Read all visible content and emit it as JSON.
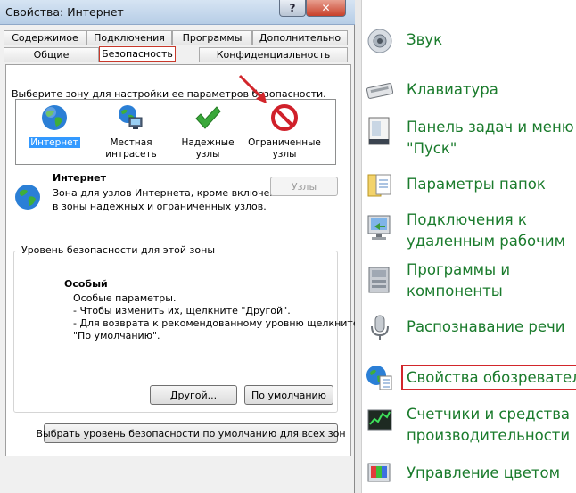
{
  "window": {
    "title": "Свойства: Интернет",
    "help_glyph": "?",
    "close_glyph": "✕"
  },
  "tabs": {
    "row1": [
      "Содержимое",
      "Подключения",
      "Программы",
      "Дополнительно"
    ],
    "row2": [
      "Общие",
      "Безопасность",
      "Конфиденциальность"
    ],
    "active": "Безопасность"
  },
  "security": {
    "instruction": "Выберите зону для настройки ее параметров безопасности.",
    "zones": [
      {
        "label_line1": "Интернет",
        "label_line2": "",
        "selected": true,
        "icon": "globe-icon"
      },
      {
        "label_line1": "Местная",
        "label_line2": "интрасеть",
        "selected": false,
        "icon": "network-globe-icon"
      },
      {
        "label_line1": "Надежные",
        "label_line2": "узлы",
        "selected": false,
        "icon": "checkmark-icon"
      },
      {
        "label_line1": "Ограниченные",
        "label_line2": "узлы",
        "selected": false,
        "icon": "no-entry-icon"
      }
    ],
    "zone_title": "Интернет",
    "zone_desc_line1": "Зона для узлов Интернета, кроме включенных",
    "zone_desc_line2": "в зоны надежных и ограниченных узлов.",
    "sites_button": "Узлы",
    "level_group_title": "Уровень безопасности для этой зоны",
    "level_name": "Особый",
    "level_lines": [
      "Особые параметры.",
      "- Чтобы изменить их, щелкните \"Другой\".",
      "- Для возврата к рекомендованному уровню щелкните",
      "\"По умолчанию\"."
    ],
    "custom_button": "Другой...",
    "default_button": "По умолчанию",
    "reset_all_button": "Выбрать уровень безопасности по умолчанию для всех зон"
  },
  "control_panel": {
    "items": [
      {
        "line1": "Звук",
        "line2": "",
        "icon": "speaker-icon"
      },
      {
        "line1": "Клавиатура",
        "line2": "",
        "icon": "keyboard-icon"
      },
      {
        "line1": "Панель задач и меню",
        "line2": "\"Пуск\"",
        "icon": "taskbar-icon"
      },
      {
        "line1": "Параметры папок",
        "line2": "",
        "icon": "folder-options-icon"
      },
      {
        "line1": "Подключения к",
        "line2": "удаленным рабочим",
        "icon": "remote-desktop-icon"
      },
      {
        "line1": "Программы и",
        "line2": "компоненты",
        "icon": "programs-icon"
      },
      {
        "line1": "Распознавание речи",
        "line2": "",
        "icon": "microphone-icon"
      },
      {
        "line1": "Свойства обозревателя",
        "line2": "",
        "icon": "internet-options-icon",
        "highlighted": true
      },
      {
        "line1": "Счетчики и средства",
        "line2": "производительности",
        "icon": "performance-icon"
      },
      {
        "line1": "Управление цветом",
        "line2": "",
        "icon": "color-management-icon"
      }
    ]
  },
  "colors": {
    "link_green": "#1a7b2c",
    "highlight_red": "#d2262b",
    "selection_blue": "#3399ff"
  }
}
